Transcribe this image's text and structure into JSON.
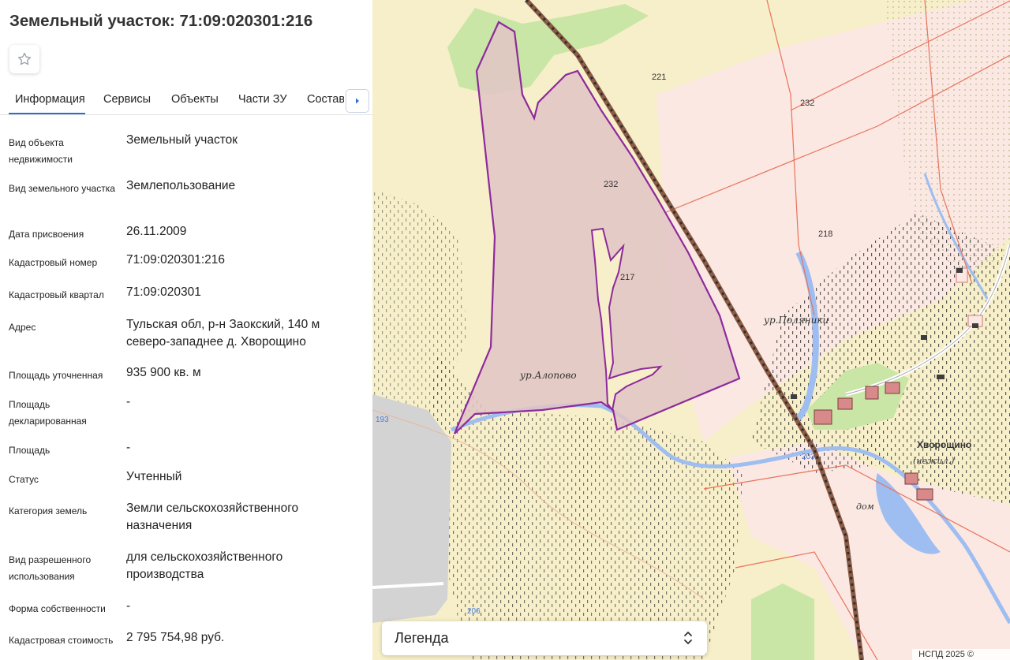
{
  "panel": {
    "title": "Земельный участок: 71:09:020301:216",
    "tabs": [
      {
        "label": "Информация"
      },
      {
        "label": "Сервисы"
      },
      {
        "label": "Объекты"
      },
      {
        "label": "Части ЗУ"
      },
      {
        "label": "Состав"
      }
    ],
    "properties": [
      {
        "label": "Вид объекта недвижимости",
        "value": "Земельный участок"
      },
      {
        "label": "Вид земельного участка",
        "value": "Землепользование"
      },
      {
        "label": "Дата присвоения",
        "value": "26.11.2009"
      },
      {
        "label": "Кадастровый номер",
        "value": "71:09:020301:216"
      },
      {
        "label": "Кадастровый квартал",
        "value": "71:09:020301"
      },
      {
        "label": "Адрес",
        "value": "Тульская обл, р-н Заокский, 140 м северо-западнее д. Хворощино"
      },
      {
        "label": "Площадь уточненная",
        "value": "935 900 кв. м"
      },
      {
        "label": "Площадь декларированная",
        "value": "-"
      },
      {
        "label": "Площадь",
        "value": "-"
      },
      {
        "label": "Статус",
        "value": "Учтенный"
      },
      {
        "label": "Категория земель",
        "value": "Земли сельскохозяйственного назначения"
      },
      {
        "label": "Вид разрешенного использования",
        "value": "для сельскохозяйственного производства"
      },
      {
        "label": "Форма собственности",
        "value": "-"
      },
      {
        "label": "Кадастровая стоимость",
        "value": "2 795 754,98 руб."
      }
    ]
  },
  "map": {
    "labels": {
      "n221": "221",
      "n232_top": "232",
      "n232_parcel": "232",
      "n218": "218",
      "n217": "217",
      "n193": "193",
      "n203": "203",
      "n206": "206",
      "alopovo": "ур.Алопово",
      "polyaniki": "ур.Поляники",
      "khvoroshchino": "Хворощино",
      "nezhil": "(нежил.)",
      "dom": "дом"
    },
    "legend_label": "Легенда",
    "attribution": "НСПД 2025 ©",
    "colors": {
      "field": "#f7efc9",
      "parcel_fill": "#e2c4c6",
      "parcel_border": "#8d2a9c",
      "cadastral_line": "#e8735a",
      "water": "#9ebdf0",
      "forest": "#c9e6a6",
      "railway": "#8a5a44"
    }
  }
}
